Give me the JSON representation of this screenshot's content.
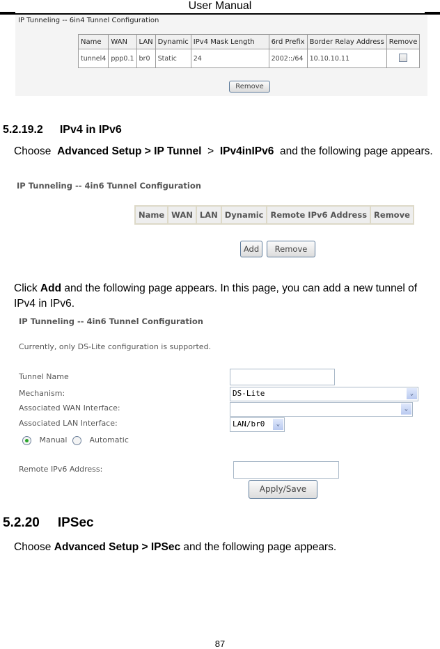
{
  "header": {
    "title": "User Manual"
  },
  "screenshot_6in4": {
    "title": "IP Tunneling -- 6in4 Tunnel Configuration",
    "columns": [
      "Name",
      "WAN",
      "LAN",
      "Dynamic",
      "IPv4 Mask Length",
      "6rd Prefix",
      "Border Relay Address",
      "Remove"
    ],
    "rows": [
      {
        "name": "tunnel4",
        "wan": "ppp0.1",
        "lan": "br0",
        "dynamic": "Static",
        "mask": "24",
        "prefix": "2002::/64",
        "relay": "10.10.10.11",
        "remove_checked": false
      }
    ],
    "remove_button": "Remove"
  },
  "section_4in6": {
    "number": "5.2.19.2",
    "title": "IPv4 in IPv6",
    "intro_choose": "Choose",
    "intro_path1": "Advanced Setup > IP Tunnel",
    "intro_sep": ">",
    "intro_path2": "IPv4inIPv6",
    "intro_rest": "and the following page appears.",
    "list_screen": {
      "title": "IP Tunneling -- 4in6 Tunnel Configuration",
      "columns": [
        "Name",
        "WAN",
        "LAN",
        "Dynamic",
        "Remote IPv6 Address",
        "Remove"
      ],
      "add_button": "Add",
      "remove_button": "Remove"
    },
    "click_text_pre": "Click",
    "click_text_bold": "Add",
    "click_text_post": "and the following page appears. In this page, you can add a new tunnel of IPv4 in IPv6.",
    "add_screen": {
      "title": "IP Tunneling -- 4in6 Tunnel Configuration",
      "note": "Currently, only DS-Lite configuration is supported.",
      "tunnel_name_label": "Tunnel Name",
      "tunnel_name_value": "",
      "mechanism_label": "Mechanism:",
      "mechanism_value": "DS-Lite",
      "wan_label": "Associated WAN Interface:",
      "wan_value": "",
      "lan_label": "Associated LAN Interface:",
      "lan_value": "LAN/br0",
      "radio_manual": "Manual",
      "radio_automatic": "Automatic",
      "radio_selected": "Manual",
      "remote_label": "Remote IPv6 Address:",
      "remote_value": "",
      "apply_button": "Apply/Save"
    }
  },
  "section_ipsec": {
    "number": "5.2.20",
    "title": "IPSec",
    "choose": "Choose",
    "path": "Advanced Setup > IPSec",
    "rest": "and the following page appears."
  },
  "footer": {
    "page_number": "87"
  }
}
